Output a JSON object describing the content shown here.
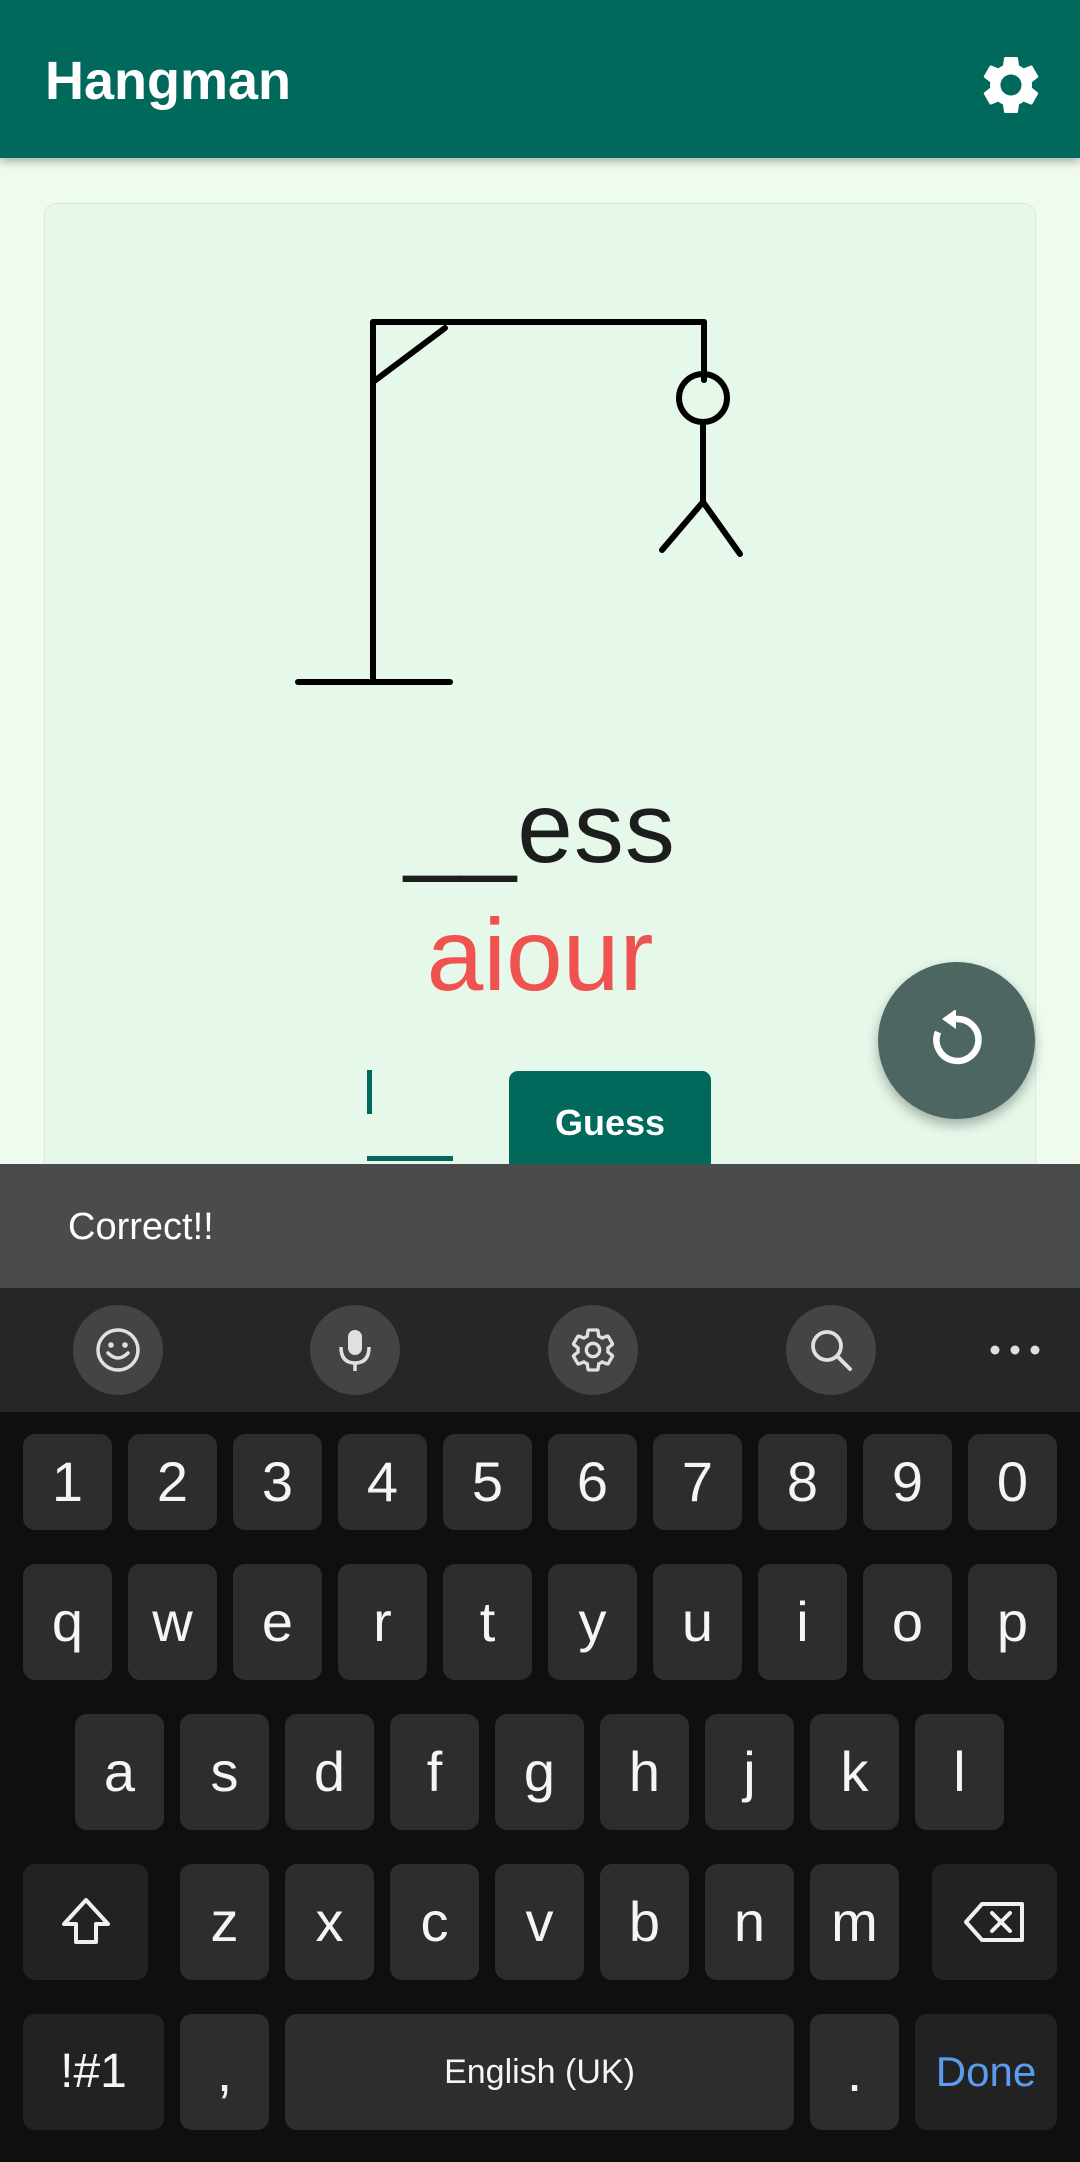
{
  "app": {
    "title": "Hangman",
    "settings_icon": "gear-icon"
  },
  "game": {
    "word": "__ess",
    "wrong_letters": "aiour",
    "guess_value": "",
    "guess_button": "Guess",
    "reset_icon": "refresh-icon"
  },
  "snackbar": {
    "message": "Correct!!"
  },
  "keyboard": {
    "toolbar": [
      "emoji-icon",
      "mic-icon",
      "settings-icon",
      "search-icon",
      "more-icon"
    ],
    "row1": [
      "1",
      "2",
      "3",
      "4",
      "5",
      "6",
      "7",
      "8",
      "9",
      "0"
    ],
    "row2": [
      "q",
      "w",
      "e",
      "r",
      "t",
      "y",
      "u",
      "i",
      "o",
      "p"
    ],
    "row3": [
      "a",
      "s",
      "d",
      "f",
      "g",
      "h",
      "j",
      "k",
      "l"
    ],
    "row4": [
      "z",
      "x",
      "c",
      "v",
      "b",
      "n",
      "m"
    ],
    "symbols": "!#1",
    "comma": ",",
    "space": "English (UK)",
    "period": ".",
    "done": "Done"
  },
  "colors": {
    "primary": "#00695c",
    "wrong": "#ef5350",
    "done": "#5b9bf0"
  }
}
